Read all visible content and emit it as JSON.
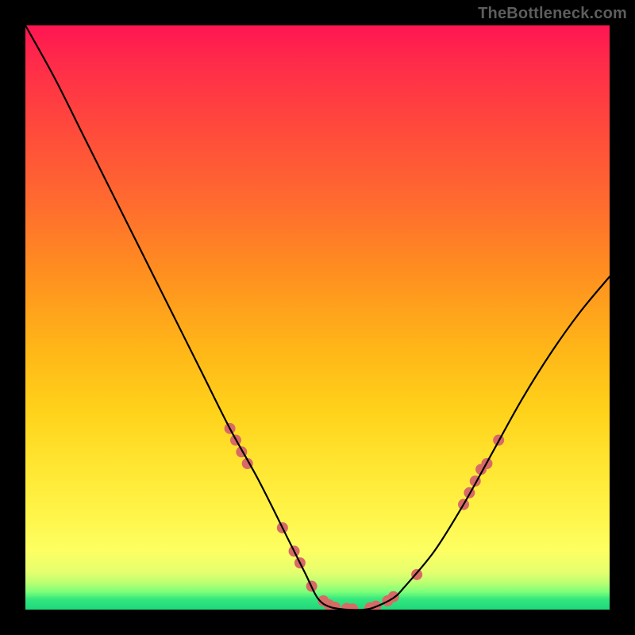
{
  "watermark": "TheBottleneck.com",
  "chart_data": {
    "type": "line",
    "title": "",
    "xlabel": "",
    "ylabel": "",
    "xlim": [
      0,
      100
    ],
    "ylim": [
      0,
      100
    ],
    "grid": false,
    "series": [
      {
        "name": "bottleneck-curve",
        "color": "#000000",
        "x": [
          0,
          5,
          10,
          15,
          20,
          25,
          30,
          35,
          40,
          45,
          48,
          50,
          52,
          55,
          58,
          60,
          63,
          65,
          70,
          75,
          80,
          85,
          90,
          95,
          100
        ],
        "y": [
          100,
          91,
          81,
          71,
          61,
          51,
          41,
          31,
          22,
          12,
          6,
          2,
          0.5,
          0,
          0,
          0.5,
          2,
          4,
          10,
          18,
          27,
          36,
          44,
          51,
          57
        ]
      }
    ],
    "markers": [
      {
        "name": "highlight-dots",
        "color": "#d86a66",
        "radius_px": 7,
        "points": [
          {
            "x": 35,
            "y": 31
          },
          {
            "x": 36,
            "y": 29
          },
          {
            "x": 37,
            "y": 27
          },
          {
            "x": 38,
            "y": 25
          },
          {
            "x": 44,
            "y": 14
          },
          {
            "x": 46,
            "y": 10
          },
          {
            "x": 47,
            "y": 8
          },
          {
            "x": 49,
            "y": 4
          },
          {
            "x": 51,
            "y": 1.5
          },
          {
            "x": 52,
            "y": 0.8
          },
          {
            "x": 53,
            "y": 0.4
          },
          {
            "x": 55,
            "y": 0.2
          },
          {
            "x": 56,
            "y": 0.1
          },
          {
            "x": 59,
            "y": 0.3
          },
          {
            "x": 60,
            "y": 0.6
          },
          {
            "x": 62,
            "y": 1.5
          },
          {
            "x": 63,
            "y": 2.2
          },
          {
            "x": 67,
            "y": 6
          },
          {
            "x": 75,
            "y": 18
          },
          {
            "x": 76,
            "y": 20
          },
          {
            "x": 77,
            "y": 22
          },
          {
            "x": 78,
            "y": 24
          },
          {
            "x": 79,
            "y": 25
          },
          {
            "x": 81,
            "y": 29
          }
        ]
      }
    ]
  }
}
